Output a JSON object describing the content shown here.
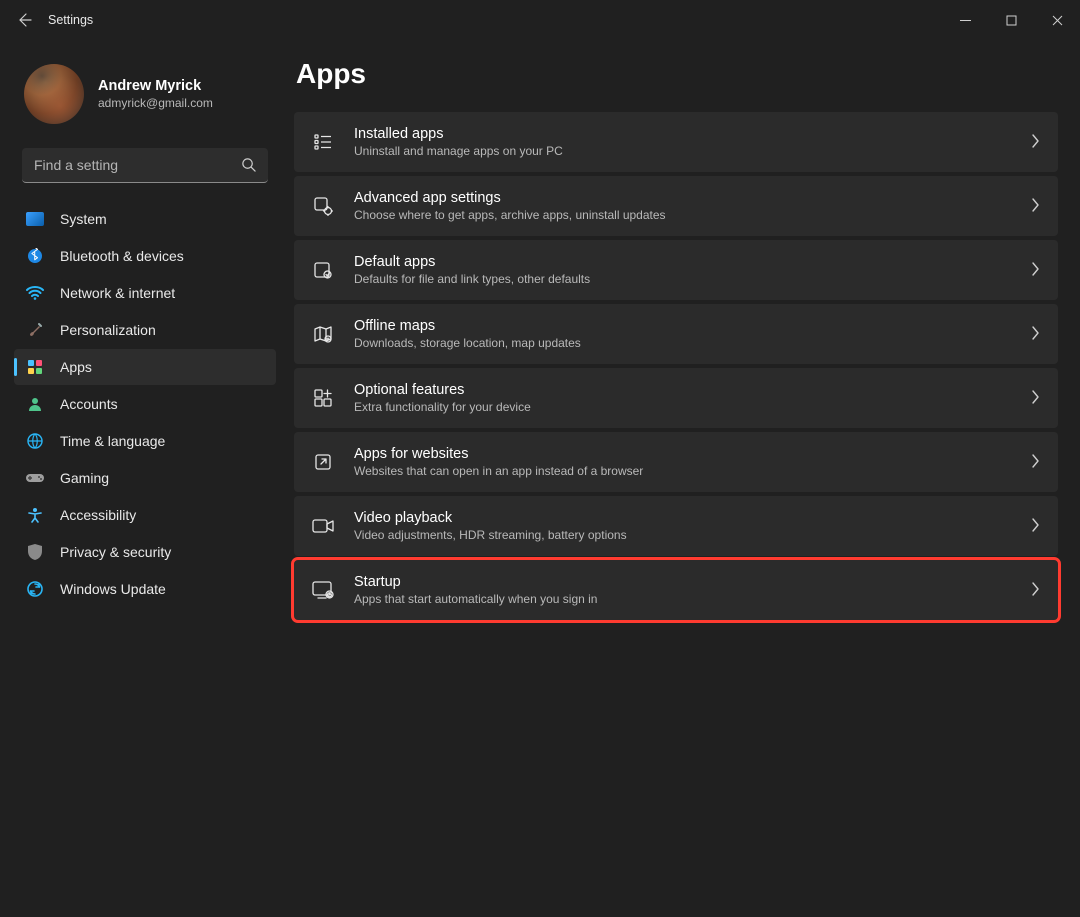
{
  "window": {
    "title": "Settings"
  },
  "profile": {
    "name": "Andrew Myrick",
    "email": "admyrick@gmail.com"
  },
  "search": {
    "placeholder": "Find a setting"
  },
  "nav": {
    "items": [
      {
        "label": "System"
      },
      {
        "label": "Bluetooth & devices"
      },
      {
        "label": "Network & internet"
      },
      {
        "label": "Personalization"
      },
      {
        "label": "Apps"
      },
      {
        "label": "Accounts"
      },
      {
        "label": "Time & language"
      },
      {
        "label": "Gaming"
      },
      {
        "label": "Accessibility"
      },
      {
        "label": "Privacy & security"
      },
      {
        "label": "Windows Update"
      }
    ]
  },
  "page": {
    "title": "Apps"
  },
  "rows": [
    {
      "title": "Installed apps",
      "sub": "Uninstall and manage apps on your PC"
    },
    {
      "title": "Advanced app settings",
      "sub": "Choose where to get apps, archive apps, uninstall updates"
    },
    {
      "title": "Default apps",
      "sub": "Defaults for file and link types, other defaults"
    },
    {
      "title": "Offline maps",
      "sub": "Downloads, storage location, map updates"
    },
    {
      "title": "Optional features",
      "sub": "Extra functionality for your device"
    },
    {
      "title": "Apps for websites",
      "sub": "Websites that can open in an app instead of a browser"
    },
    {
      "title": "Video playback",
      "sub": "Video adjustments, HDR streaming, battery options"
    },
    {
      "title": "Startup",
      "sub": "Apps that start automatically when you sign in"
    }
  ]
}
